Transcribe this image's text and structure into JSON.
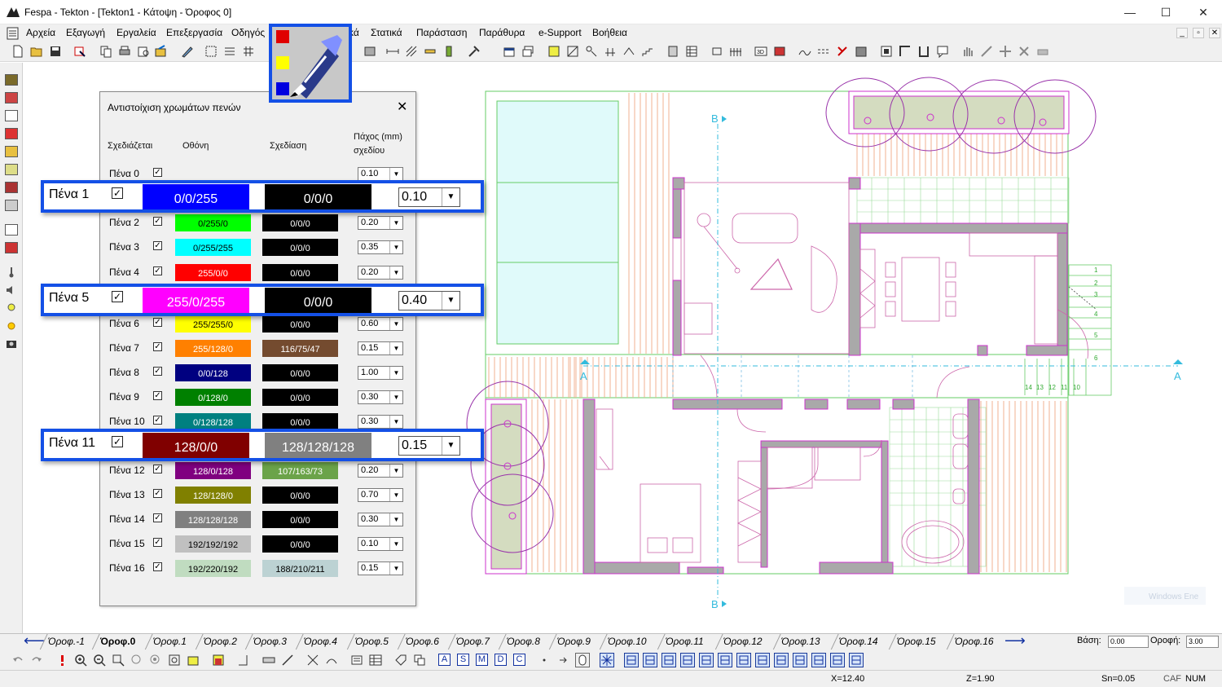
{
  "window": {
    "title": "Fespa - Tekton - [Tekton1 - Κάτοψη - Όροφος 0]",
    "minimize": "—",
    "maximize": "☐",
    "close": "✕"
  },
  "menu": [
    "Αρχεία",
    "Εξαγωγή",
    "Εργαλεία",
    "Επεξεργασία",
    "Οδηγός",
    "κά",
    "Στατικά",
    "Παράσταση",
    "Παράθυρα",
    "e-Support",
    "Βοήθεια"
  ],
  "mdi_controls": [
    "_",
    "▫",
    "✕"
  ],
  "dialog": {
    "title": "Αντιστοίχιση χρωμάτων πενών",
    "close": "✕",
    "headers": {
      "drawn": "Σχεδιάζεται",
      "screen": "Οθόνη",
      "plot": "Σχεδίαση",
      "thickness_line1": "Πάχος (mm)",
      "thickness_line2": "σχεδίου"
    },
    "rows": [
      {
        "label": "Πένα 0",
        "checked": "✓",
        "screen": "",
        "screen_color": "#f0f0f0",
        "plot": "",
        "plot_color": "#f0f0f0",
        "thickness": "0.10"
      },
      {
        "label": "Πένα 2",
        "checked": "✓",
        "screen": "0/255/0",
        "screen_color": "#00ff00",
        "plot": "0/0/0",
        "plot_color": "#000000",
        "thickness": "0.20"
      },
      {
        "label": "Πένα 3",
        "checked": "✓",
        "screen": "0/255/255",
        "screen_color": "#00ffff",
        "plot": "0/0/0",
        "plot_color": "#000000",
        "thickness": "0.35"
      },
      {
        "label": "Πένα 4",
        "checked": "✓",
        "screen": "255/0/0",
        "screen_color": "#ff0000",
        "plot": "0/0/0",
        "plot_color": "#000000",
        "thickness": "0.20"
      },
      {
        "label": "Πένα 6",
        "checked": "✓",
        "screen": "255/255/0",
        "screen_color": "#ffff00",
        "plot": "0/0/0",
        "plot_color": "#000000",
        "thickness": "0.60"
      },
      {
        "label": "Πένα 7",
        "checked": "✓",
        "screen": "255/128/0",
        "screen_color": "#ff8000",
        "plot": "116/75/47",
        "plot_color": "#744b2f",
        "thickness": "0.15"
      },
      {
        "label": "Πένα 8",
        "checked": "✓",
        "screen": "0/0/128",
        "screen_color": "#000080",
        "plot": "0/0/0",
        "plot_color": "#000000",
        "thickness": "1.00"
      },
      {
        "label": "Πένα 9",
        "checked": "✓",
        "screen": "0/128/0",
        "screen_color": "#008000",
        "plot": "0/0/0",
        "plot_color": "#000000",
        "thickness": "0.30"
      },
      {
        "label": "Πένα 10",
        "checked": "✓",
        "screen": "0/128/128",
        "screen_color": "#008080",
        "plot": "0/0/0",
        "plot_color": "#000000",
        "thickness": "0.30"
      },
      {
        "label": "Πένα 12",
        "checked": "✓",
        "screen": "128/0/128",
        "screen_color": "#800080",
        "plot": "107/163/73",
        "plot_color": "#6ba349",
        "thickness": "0.20"
      },
      {
        "label": "Πένα 13",
        "checked": "✓",
        "screen": "128/128/0",
        "screen_color": "#808000",
        "plot": "0/0/0",
        "plot_color": "#000000",
        "thickness": "0.70"
      },
      {
        "label": "Πένα 14",
        "checked": "✓",
        "screen": "128/128/128",
        "screen_color": "#808080",
        "plot": "0/0/0",
        "plot_color": "#000000",
        "thickness": "0.30"
      },
      {
        "label": "Πένα 15",
        "checked": "✓",
        "screen": "192/192/192",
        "screen_color": "#c0c0c0",
        "plot": "0/0/0",
        "plot_color": "#000000",
        "thickness": "0.10"
      },
      {
        "label": "Πένα 16",
        "checked": "✓",
        "screen": "192/220/192",
        "screen_color": "#c0dcc0",
        "plot": "188/210/211",
        "plot_color": "#bcd2d3",
        "thickness": "0.15"
      }
    ]
  },
  "callouts": [
    {
      "label": "Πένα 1",
      "checked": "✓",
      "screen": "0/0/255",
      "screen_color": "#0000ff",
      "plot": "0/0/0",
      "plot_color": "#000000",
      "thickness": "0.10"
    },
    {
      "label": "Πένα 5",
      "checked": "✓",
      "screen": "255/0/255",
      "screen_color": "#ff00ff",
      "plot": "0/0/0",
      "plot_color": "#000000",
      "thickness": "0.40"
    },
    {
      "label": "Πένα 11",
      "checked": "✓",
      "screen": "128/0/0",
      "screen_color": "#800000",
      "plot": "128/128/128",
      "plot_color": "#808080",
      "thickness": "0.15"
    }
  ],
  "combo_arrow": "▼",
  "plan": {
    "axis_labels": [
      "B",
      "B",
      "A",
      "A"
    ],
    "stair_numbers_right": [
      "1",
      "2",
      "3",
      "4",
      "5",
      "6"
    ],
    "stair_numbers_bottom": [
      "14",
      "13",
      "12",
      "11",
      "10"
    ],
    "faded_text": "Windows Ene"
  },
  "tabs": {
    "left_arrow": "⟵",
    "right_arrow": "⟶",
    "items": [
      "Όροφ.-1",
      "Όροφ.0",
      "Όροφ.1",
      "Όροφ.2",
      "Όροφ.3",
      "Όροφ.4",
      "Όροφ.5",
      "Όροφ.6",
      "Όροφ.7",
      "Όροφ.8",
      "Όροφ.9",
      "Όροφ.10",
      "Όροφ.11",
      "Όροφ.12",
      "Όροφ.13",
      "Όροφ.14",
      "Όροφ.15",
      "Όροφ.16"
    ],
    "base_label": "Βάση:",
    "base_value": "0.00",
    "roof_label": "Οροφή:",
    "roof_value": "3.00"
  },
  "bottom_toolbar_letters": [
    "A",
    "S",
    "M",
    "D",
    "C"
  ],
  "status": {
    "x": "X=12.40",
    "z": "Z=1.90",
    "sn": "Sn=0.05",
    "caps": "CAF",
    "num": "NUM"
  },
  "colors": {
    "accent_blue": "#1450e6",
    "plan_magenta": "#cc33cc",
    "plan_green": "#4caf50",
    "plan_cyan": "#33bbdd",
    "plan_orange": "#e8a070",
    "plan_wall_gray": "#a9a9a9"
  }
}
